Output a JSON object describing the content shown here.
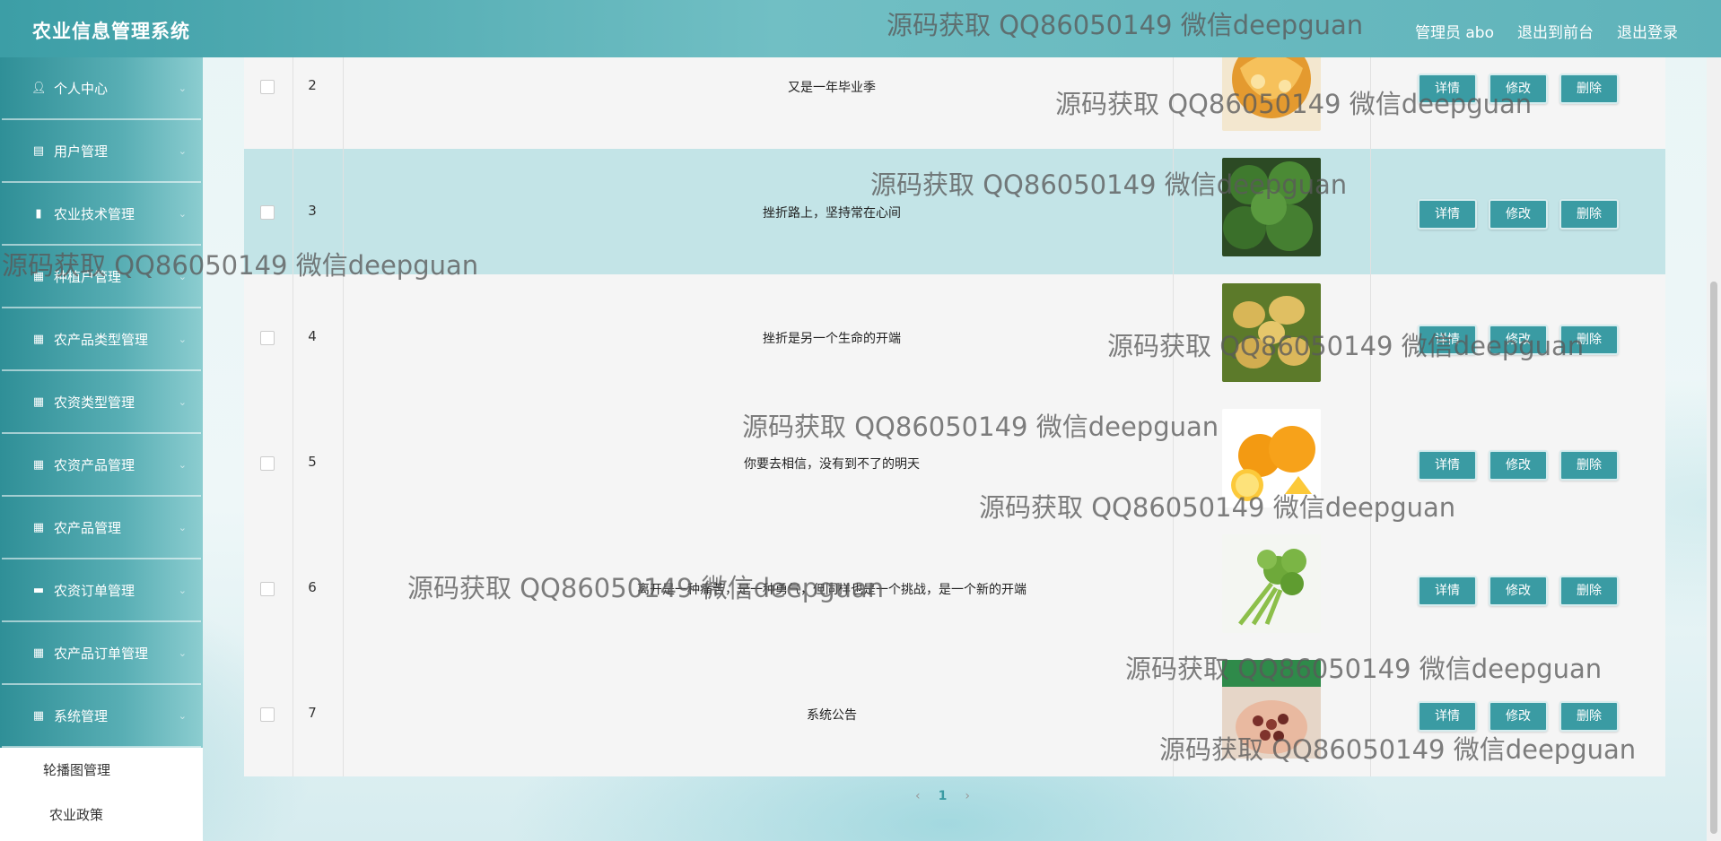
{
  "header": {
    "app_title": "农业信息管理系统",
    "nav": [
      "管理员 abo",
      "退出到前台",
      "退出登录"
    ]
  },
  "sidebar": {
    "items": [
      {
        "label": "个人中心",
        "icon": "user-icon"
      },
      {
        "label": "用户管理",
        "icon": "clipboard-icon"
      },
      {
        "label": "农业技术管理",
        "icon": "bar-chart-icon"
      },
      {
        "label": "种植户管理",
        "icon": "grid-icon"
      },
      {
        "label": "农产品类型管理",
        "icon": "grid-icon"
      },
      {
        "label": "农资类型管理",
        "icon": "grid-icon"
      },
      {
        "label": "农资产品管理",
        "icon": "grid-icon"
      },
      {
        "label": "农产品管理",
        "icon": "grid-icon"
      },
      {
        "label": "农资订单管理",
        "icon": "monitor-icon"
      },
      {
        "label": "农产品订单管理",
        "icon": "grid-icon"
      },
      {
        "label": "系统管理",
        "icon": "grid-icon"
      }
    ],
    "submenu": [
      "轮播图管理",
      "农业政策"
    ]
  },
  "table": {
    "actions": {
      "detail": "详情",
      "edit": "修改",
      "delete": "删除"
    },
    "rows": [
      {
        "index": "2",
        "title": "又是一年毕业季",
        "image": "pumpkin",
        "highlight": false
      },
      {
        "index": "3",
        "title": "挫折路上，坚持常在心间",
        "image": "broccoli",
        "highlight": true
      },
      {
        "index": "4",
        "title": "挫折是另一个生命的开端",
        "image": "potatoes",
        "highlight": false
      },
      {
        "index": "5",
        "title": "你要去相信，没有到不了的明天",
        "image": "oranges",
        "highlight": false
      },
      {
        "index": "6",
        "title": "离开是一种痛苦，是一种勇气，但同样也是一个挑战，是一个新的开端",
        "image": "celery",
        "highlight": false
      },
      {
        "index": "7",
        "title": "系统公告",
        "image": "beans",
        "highlight": false
      }
    ]
  },
  "pagination": {
    "prev": "‹",
    "current": "1",
    "next": "›"
  },
  "watermark": "源码获取 QQ86050149 微信deepguan",
  "colors": {
    "accent": "#3a9ba3",
    "highlight_row": "#c3e4e7"
  }
}
